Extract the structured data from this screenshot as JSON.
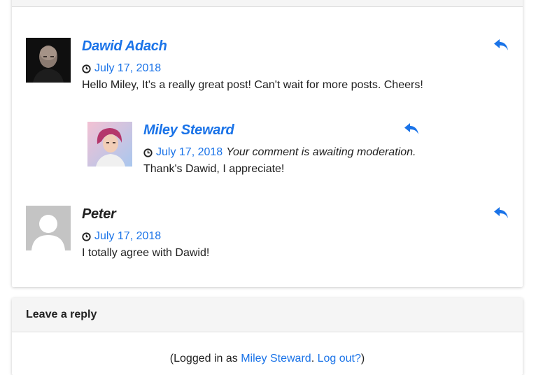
{
  "comments": [
    {
      "author": "Dawid Adach",
      "date": "July 17, 2018",
      "text": "Hello Miley, It's a really great post! Can't wait for more posts. Cheers!",
      "avatar": "photo-man-icon",
      "reply_icon": "reply-icon"
    },
    {
      "author": "Miley Steward",
      "date": "July 17, 2018",
      "moderation": "Your comment is awaiting moderation.",
      "text": "Thank's Dawid, I appreciate!",
      "avatar": "photo-woman-icon",
      "reply_icon": "reply-icon"
    },
    {
      "author": "Peter",
      "date": "July 17, 2018",
      "text": "I totally agree with Dawid!",
      "avatar": "default-user-icon",
      "reply_icon": "reply-icon"
    }
  ],
  "reply_section": {
    "title": "Leave a reply",
    "logged_prefix": "(Logged in as ",
    "user_link": "Miley Steward",
    "separator": ". ",
    "logout_link": "Log out?",
    "logged_suffix": ")"
  },
  "colors": {
    "link": "#1a73e8",
    "text": "#212121",
    "header_bg": "#f5f5f5"
  }
}
